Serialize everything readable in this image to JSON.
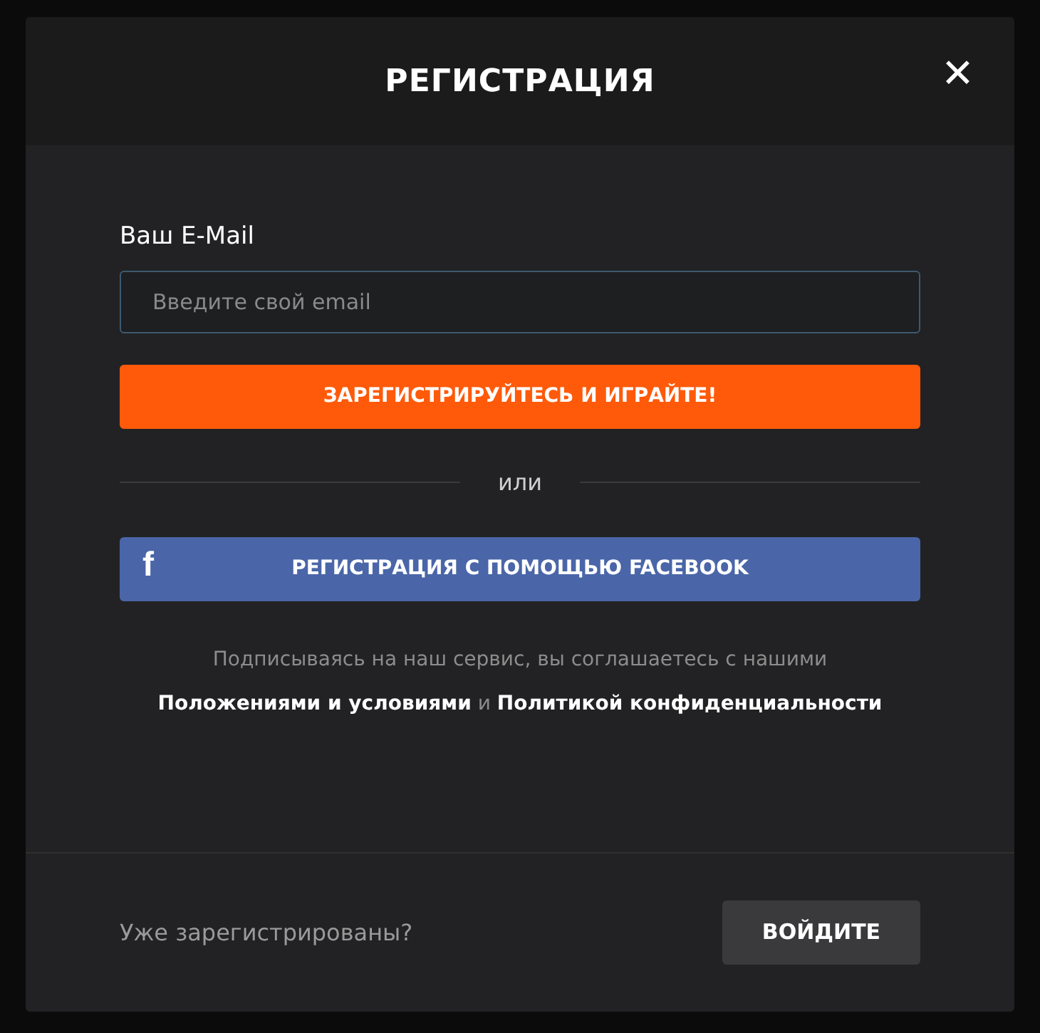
{
  "dialog": {
    "title": "РЕГИСТРАЦИЯ",
    "close": "✕"
  },
  "email": {
    "label": "Ваш E-Mail",
    "placeholder": "Введите свой email"
  },
  "register_button": "ЗАРЕГИСТРИРУЙТЕСЬ И ИГРАЙТЕ!",
  "divider": "или",
  "facebook_button": {
    "icon": "f",
    "label": "РЕГИСТРАЦИЯ С ПОМОЩЬЮ FACEBOOK"
  },
  "terms": {
    "text": "Подписываясь на наш сервис, вы соглашаетесь с нашими",
    "link_1": "Положениями и условиями",
    "joiner": "и",
    "link_2": "Политикой конфиденциальности"
  },
  "footer": {
    "prompt": "Уже зарегистрированы?",
    "login_button": "ВОЙДИТЕ"
  }
}
